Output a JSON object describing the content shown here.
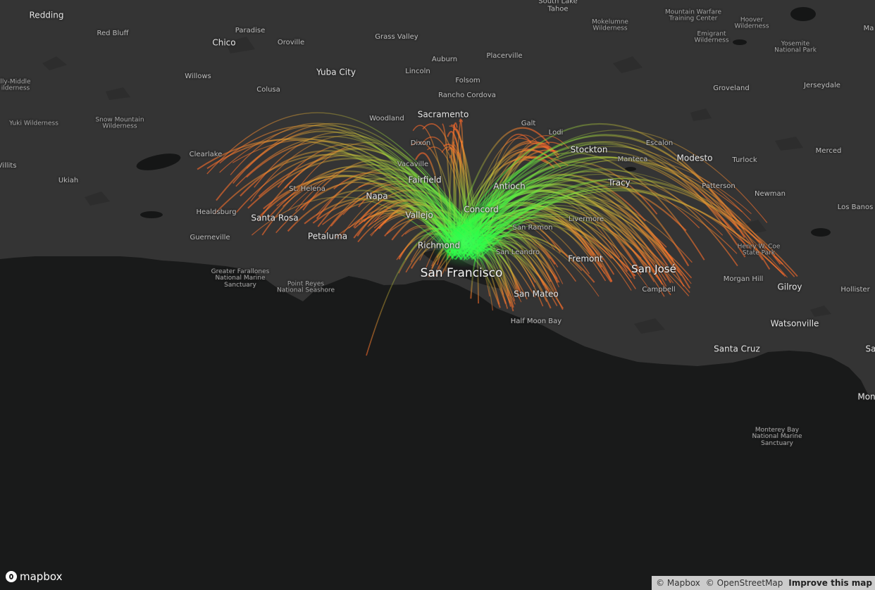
{
  "map": {
    "colors": {
      "water": "#191a1a",
      "land": "#343434",
      "lakes": "#151616",
      "arc_origin": "#22ff44",
      "arc_destination": "#ff6a2a",
      "arc_mid": "#c8c83a"
    },
    "flow_map": {
      "origin_area": "San Francisco Bay Area (Concord / Richmond)",
      "arc_colors": [
        "green",
        "yellow",
        "orange"
      ]
    }
  },
  "labels": [
    {
      "name": "label-redding",
      "text": "Redding",
      "cls": "city-md"
    },
    {
      "name": "label-red-bluff",
      "text": "Red Bluff",
      "cls": "city-sm"
    },
    {
      "name": "label-chico",
      "text": "Chico",
      "cls": "city-md"
    },
    {
      "name": "label-paradise",
      "text": "Paradise",
      "cls": "city-sm"
    },
    {
      "name": "label-oroville",
      "text": "Oroville",
      "cls": "city-sm"
    },
    {
      "name": "label-grass-valley",
      "text": "Grass Valley",
      "cls": "city-sm"
    },
    {
      "name": "label-south-lake-tahoe",
      "text": "South Lake\nTahoe",
      "cls": "city-sm"
    },
    {
      "name": "label-mokelumne",
      "text": "Mokelumne\nWilderness",
      "cls": "park"
    },
    {
      "name": "label-mountain-warfare",
      "text": "Mountain Warfare\nTraining Center",
      "cls": "park"
    },
    {
      "name": "label-hoover",
      "text": "Hoover\nWilderness",
      "cls": "park"
    },
    {
      "name": "label-emigrant",
      "text": "Emigrant\nWilderness",
      "cls": "park"
    },
    {
      "name": "label-yosemite",
      "text": "Yosemite\nNational Park",
      "cls": "park"
    },
    {
      "name": "label-ma",
      "text": "Ma",
      "cls": "city-sm"
    },
    {
      "name": "label-yuba-city",
      "text": "Yuba City",
      "cls": "city-md"
    },
    {
      "name": "label-lincoln",
      "text": "Lincoln",
      "cls": "city-sm"
    },
    {
      "name": "label-auburn",
      "text": "Auburn",
      "cls": "city-sm"
    },
    {
      "name": "label-placerville",
      "text": "Placerville",
      "cls": "city-sm"
    },
    {
      "name": "label-folsom",
      "text": "Folsom",
      "cls": "city-sm"
    },
    {
      "name": "label-willows",
      "text": "Willows",
      "cls": "city-sm"
    },
    {
      "name": "label-colusa",
      "text": "Colusa",
      "cls": "city-sm"
    },
    {
      "name": "label-rancho-cordova",
      "text": "Rancho Cordova",
      "cls": "city-sm"
    },
    {
      "name": "label-sacramento",
      "text": "Sacramento",
      "cls": "city-md"
    },
    {
      "name": "label-groveland",
      "text": "Groveland",
      "cls": "city-sm"
    },
    {
      "name": "label-jerseydale",
      "text": "Jerseydale",
      "cls": "city-sm"
    },
    {
      "name": "label-middle-wilderness",
      "text": "lly-Middle\nilderness",
      "cls": "park"
    },
    {
      "name": "label-yuki",
      "text": "Yuki Wilderness",
      "cls": "park"
    },
    {
      "name": "label-snow-mountain",
      "text": "Snow Mountain\nWilderness",
      "cls": "park"
    },
    {
      "name": "label-woodland",
      "text": "Woodland",
      "cls": "city-sm"
    },
    {
      "name": "label-galt",
      "text": "Galt",
      "cls": "city-sm"
    },
    {
      "name": "label-lodi",
      "text": "Lodi",
      "cls": "city-sm"
    },
    {
      "name": "label-dixon",
      "text": "Dixon",
      "cls": "city-sm"
    },
    {
      "name": "label-stockton",
      "text": "Stockton",
      "cls": "city-md"
    },
    {
      "name": "label-escalon",
      "text": "Escalon",
      "cls": "city-sm"
    },
    {
      "name": "label-merced",
      "text": "Merced",
      "cls": "city-sm"
    },
    {
      "name": "label-clearlake",
      "text": "Clearlake",
      "cls": "city-sm"
    },
    {
      "name": "label-vacaville",
      "text": "Vacaville",
      "cls": "city-sm"
    },
    {
      "name": "label-manteca",
      "text": "Manteca",
      "cls": "city-sm"
    },
    {
      "name": "label-modesto",
      "text": "Modesto",
      "cls": "city-md"
    },
    {
      "name": "label-willits",
      "text": "Villits",
      "cls": "city-sm"
    },
    {
      "name": "label-turlock",
      "text": "Turlock",
      "cls": "city-sm"
    },
    {
      "name": "label-fairfield",
      "text": "Fairfield",
      "cls": "city-md"
    },
    {
      "name": "label-ukiah",
      "text": "Ukiah",
      "cls": "city-sm"
    },
    {
      "name": "label-tracy",
      "text": "Tracy",
      "cls": "city-md"
    },
    {
      "name": "label-antioch",
      "text": "Antioch",
      "cls": "city-md"
    },
    {
      "name": "label-st-helena",
      "text": "St. Helena",
      "cls": "city-sm"
    },
    {
      "name": "label-patterson",
      "text": "Patterson",
      "cls": "city-sm"
    },
    {
      "name": "label-napa",
      "text": "Napa",
      "cls": "city-md"
    },
    {
      "name": "label-newman",
      "text": "Newman",
      "cls": "city-sm"
    },
    {
      "name": "label-los-banos",
      "text": "Los Banos",
      "cls": "city-sm"
    },
    {
      "name": "label-concord",
      "text": "Concord",
      "cls": "city-md"
    },
    {
      "name": "label-healdsburg",
      "text": "Healdsburg",
      "cls": "city-sm"
    },
    {
      "name": "label-vallejo",
      "text": "Vallejo",
      "cls": "city-md"
    },
    {
      "name": "label-santa-rosa",
      "text": "Santa Rosa",
      "cls": "city-md"
    },
    {
      "name": "label-livermore",
      "text": "Livermore",
      "cls": "city-sm"
    },
    {
      "name": "label-san-ramon",
      "text": "San Ramon",
      "cls": "city-sm"
    },
    {
      "name": "label-guerneville",
      "text": "Guerneville",
      "cls": "city-sm"
    },
    {
      "name": "label-petaluma",
      "text": "Petaluma",
      "cls": "city-md"
    },
    {
      "name": "label-richmond",
      "text": "Richmond",
      "cls": "city-md"
    },
    {
      "name": "label-henry-coe",
      "text": "Henry W. Coe\nState Park",
      "cls": "park"
    },
    {
      "name": "label-san-leandro",
      "text": "San Leandro",
      "cls": "city-sm"
    },
    {
      "name": "label-fremont",
      "text": "Fremont",
      "cls": "city-md"
    },
    {
      "name": "label-farallones",
      "text": "Greater Farallones\nNational Marine\nSanctuary",
      "cls": "park"
    },
    {
      "name": "label-san-jose",
      "text": "San José",
      "cls": "city-lg"
    },
    {
      "name": "label-san-francisco",
      "text": "San Francisco",
      "cls": "big"
    },
    {
      "name": "label-point-reyes",
      "text": "Point Reyes\nNational Seashore",
      "cls": "park"
    },
    {
      "name": "label-morgan-hill",
      "text": "Morgan Hill",
      "cls": "city-sm"
    },
    {
      "name": "label-gilroy",
      "text": "Gilroy",
      "cls": "city-md"
    },
    {
      "name": "label-campbell",
      "text": "Campbell",
      "cls": "city-sm"
    },
    {
      "name": "label-hollister",
      "text": "Hollister",
      "cls": "city-sm"
    },
    {
      "name": "label-san-mateo",
      "text": "San Mateo",
      "cls": "city-md"
    },
    {
      "name": "label-half-moon-bay",
      "text": "Half Moon Bay",
      "cls": "city-sm"
    },
    {
      "name": "label-watsonville",
      "text": "Watsonville",
      "cls": "city-md"
    },
    {
      "name": "label-santa-cruz",
      "text": "Santa Cruz",
      "cls": "city-md"
    },
    {
      "name": "label-sa",
      "text": "Sa",
      "cls": "city-md"
    },
    {
      "name": "label-mon",
      "text": "Mon",
      "cls": "city-md"
    },
    {
      "name": "label-monterey-bay",
      "text": "Monterey Bay\nNational Marine\nSanctuary",
      "cls": "park"
    }
  ],
  "footer": {
    "logo_text": "mapbox",
    "attribution": {
      "mapbox": "© Mapbox",
      "osm": "© OpenStreetMap",
      "improve": "Improve this map"
    }
  }
}
